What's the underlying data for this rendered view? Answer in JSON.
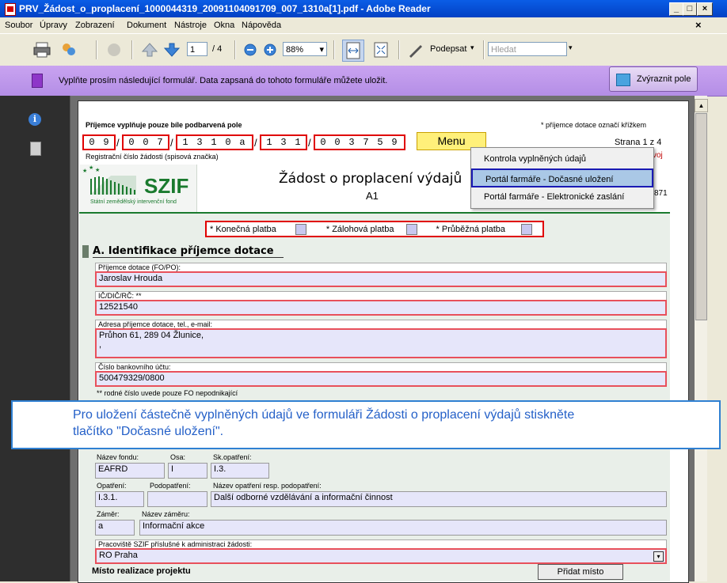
{
  "window": {
    "title": "PRV_Žádost_o_proplacení_1000044319_20091104091709_007_1310a[1].pdf - Adobe Reader"
  },
  "menubar": {
    "items": [
      "Soubor",
      "Úpravy",
      "Zobrazení",
      "Dokument",
      "Nástroje",
      "Okna",
      "Nápověda"
    ],
    "close": "×"
  },
  "toolbar": {
    "page_current": "1",
    "page_total": "/ 4",
    "zoom": "88%",
    "sign_label": "Podepsat",
    "search_placeholder": "Hledat"
  },
  "banner": {
    "message": "Vyplňte prosím následující formulář. Data zapsaná do tohoto formuláře můžete uložit.",
    "highlight_button": "Zvýraznit pole"
  },
  "form": {
    "header_left": "Příjemce vyplňuje pouze bíle podbarvená pole",
    "header_right": "* příjemce dotace označí křížkem",
    "page_label": "Strana 1 z 4",
    "reg_groups": [
      [
        "0",
        "9"
      ],
      [
        "0",
        "0",
        "7"
      ],
      [
        "1",
        "3",
        "1",
        "0",
        "a"
      ],
      [
        "1",
        "3",
        "1"
      ],
      [
        "0",
        "0",
        "3",
        "7",
        "5",
        "9"
      ]
    ],
    "reg_label": "Registrační číslo žádosti (spisová značka)",
    "menu_button": "Menu",
    "logo_text": "SZIF",
    "logo_sub": "Státní zemědělský intervenční fond",
    "title": "Žádost o proplacení výdajů",
    "subtitle": "A1",
    "version_peek": "871",
    "vvoj_peek": "voj",
    "payments": [
      "* Konečná platba",
      "* Zálohová platba",
      "* Průběžná platba"
    ],
    "section_a": "A. Identifikace příjemce dotace",
    "fields": [
      {
        "label": "Příjemce dotace (FO/PO):",
        "value": "Jaroslav Hrouda"
      },
      {
        "label": "IČ/DIČ/RČ:  **",
        "value": "12521540"
      },
      {
        "label": "Adresa příjemce dotace, tel., e-mail:",
        "value": "Průhon 61, 289 04 Žlunice,",
        "value2": ","
      },
      {
        "label": "Číslo bankovního účtu:",
        "value": "500479329/0800"
      }
    ],
    "note": "** rodné číslo uvede pouze FO nepodnikající",
    "fund_label": "Název fondu:",
    "fund_value": "EAFRD",
    "axis_label": "Osa:",
    "axis_value": "I",
    "measure_label": "Sk.opatření:",
    "measure_value": "I.3.",
    "op_label": "Opatření:",
    "op_value": "I.3.1.",
    "subop_label": "Podopatření:",
    "subop_value": "",
    "opname_label": "Název opatření resp. podopatření:",
    "opname_value": "Další odborné vzdělávání a informační činnost",
    "intent_label": "Záměr:",
    "intent_value": "a",
    "intentname_label": "Název záměru:",
    "intentname_value": "Informační akce",
    "office_label": "Pracoviště SZIF příslušné k administraci žádosti:",
    "office_value": "RO Praha",
    "place_label": "Místo realizace projektu",
    "add_place": "Přidat místo"
  },
  "dropdown": {
    "items": [
      "Kontrola vyplněných údajů",
      "Portál farmáře - Dočasné uložení",
      "Portál farmáře - Elektronické zaslání"
    ]
  },
  "callout": {
    "line1": "Pro uložení částečně vyplněných údajů ve formuláři Žádosti o proplacení výdajů stiskněte",
    "line2": "tlačítko \"Dočasné uložení\"."
  },
  "colors": {
    "accent_red": "#e00000",
    "banner": "#c9a3f0",
    "callout_blue": "#2f80d2",
    "highlight_blue": "#1a1ab4"
  }
}
